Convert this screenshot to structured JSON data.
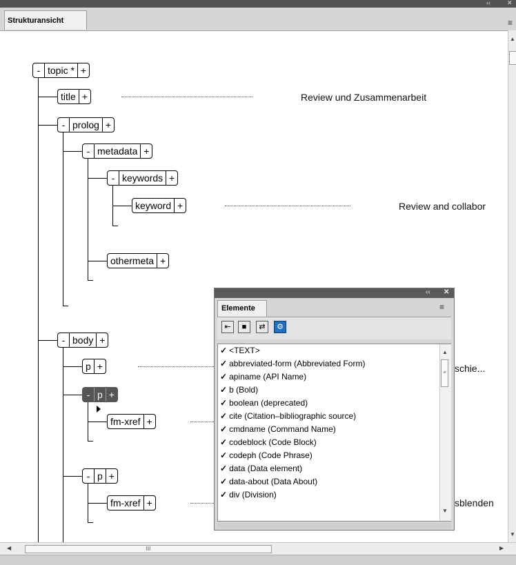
{
  "window": {
    "tab_label": "Strukturansicht",
    "collapse_glyph": "‹‹",
    "close_glyph": "✕",
    "menu_glyph": "≡"
  },
  "tree": {
    "nodes": [
      {
        "name": "topic *",
        "expand": "-",
        "add": "+"
      },
      {
        "name": "title",
        "add": "+"
      },
      {
        "name": "prolog",
        "expand": "-",
        "add": "+"
      },
      {
        "name": "metadata",
        "expand": "-",
        "add": "+"
      },
      {
        "name": "keywords",
        "expand": "-",
        "add": "+"
      },
      {
        "name": "keyword",
        "add": "+"
      },
      {
        "name": "othermeta",
        "add": "+"
      },
      {
        "name": "body",
        "expand": "-",
        "add": "+"
      },
      {
        "name": "p",
        "add": "+"
      },
      {
        "name": "p",
        "expand": "-",
        "add": "+"
      },
      {
        "name": "fm-xref",
        "add": "+"
      },
      {
        "name": "p",
        "expand": "-",
        "add": "+"
      },
      {
        "name": "fm-xref",
        "add": "+"
      }
    ],
    "values": {
      "title_text": "Review und Zusammenarbeit",
      "keyword_text": "Review and collabor",
      "p_text": "schie...",
      "fmxref_text": "sblenden"
    }
  },
  "scrollbar": {
    "thumb_grip": "III"
  },
  "panel": {
    "title": "Elemente",
    "collapse_glyph": "‹‹",
    "close_glyph": "✕",
    "menu_glyph": "≡",
    "items": [
      {
        "check": "✓",
        "label": "<TEXT>"
      },
      {
        "check": "✓",
        "label": "abbreviated-form  (Abbreviated Form)"
      },
      {
        "check": "✓",
        "label": "apiname  (API Name)"
      },
      {
        "check": "✓",
        "label": "b  (Bold)"
      },
      {
        "check": "✓",
        "label": "boolean  (deprecated)"
      },
      {
        "check": "✓",
        "label": "cite  (Citation–bibliographic source)"
      },
      {
        "check": "✓",
        "label": "cmdname  (Command Name)"
      },
      {
        "check": "✓",
        "label": "codeblock  (Code Block)"
      },
      {
        "check": "✓",
        "label": "codeph  (Code Phrase)"
      },
      {
        "check": "✓",
        "label": "data  (Data element)"
      },
      {
        "check": "✓",
        "label": "data-about  (Data About)"
      },
      {
        "check": "✓",
        "label": "div  (Division)"
      }
    ]
  }
}
